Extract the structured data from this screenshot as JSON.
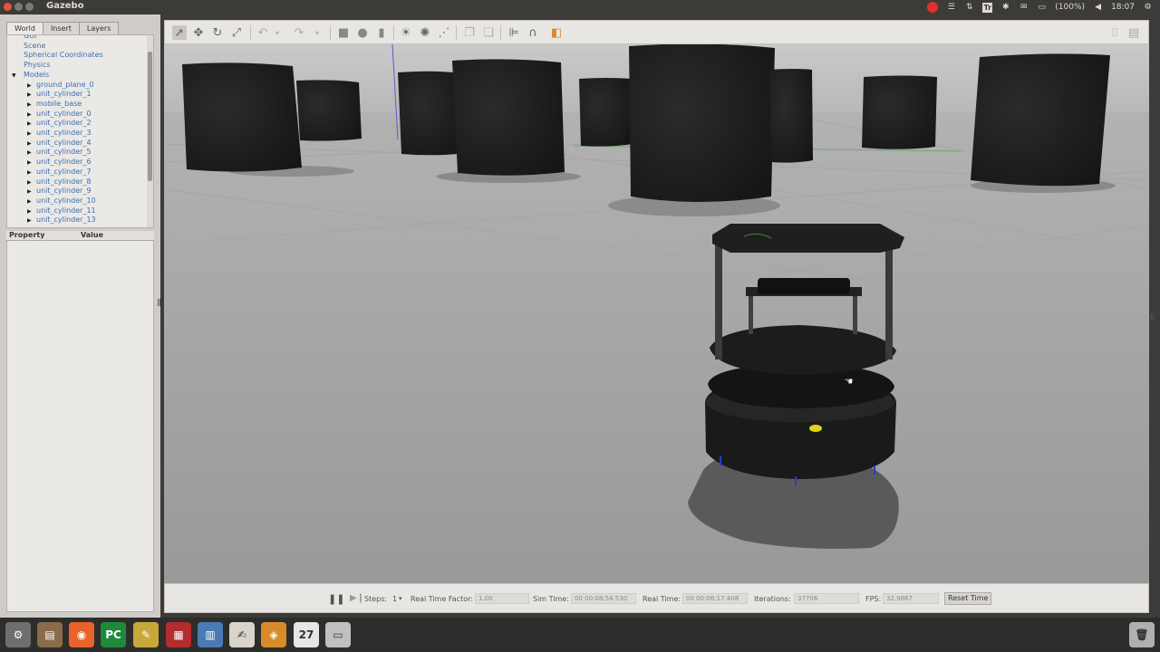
{
  "window": {
    "title": "Gazebo"
  },
  "tray": {
    "battery": "(100%)",
    "clock": "18:07",
    "keyboard": "Tr"
  },
  "left_panel": {
    "tabs": [
      "World",
      "Insert",
      "Layers"
    ],
    "tree_items": [
      {
        "label": "GUI",
        "indent": 0,
        "arrow": ""
      },
      {
        "label": "Scene",
        "indent": 0,
        "arrow": ""
      },
      {
        "label": "Spherical Coordinates",
        "indent": 0,
        "arrow": ""
      },
      {
        "label": "Physics",
        "indent": 0,
        "arrow": ""
      },
      {
        "label": "Models",
        "indent": 0,
        "arrow": "down"
      },
      {
        "label": "ground_plane_0",
        "indent": 1,
        "arrow": "right"
      },
      {
        "label": "unit_cylinder_1",
        "indent": 1,
        "arrow": "right"
      },
      {
        "label": "mobile_base",
        "indent": 1,
        "arrow": "right"
      },
      {
        "label": "unit_cylinder_0",
        "indent": 1,
        "arrow": "right"
      },
      {
        "label": "unit_cylinder_2",
        "indent": 1,
        "arrow": "right"
      },
      {
        "label": "unit_cylinder_3",
        "indent": 1,
        "arrow": "right"
      },
      {
        "label": "unit_cylinder_4",
        "indent": 1,
        "arrow": "right"
      },
      {
        "label": "unit_cylinder_5",
        "indent": 1,
        "arrow": "right"
      },
      {
        "label": "unit_cylinder_6",
        "indent": 1,
        "arrow": "right"
      },
      {
        "label": "unit_cylinder_7",
        "indent": 1,
        "arrow": "right"
      },
      {
        "label": "unit_cylinder_8",
        "indent": 1,
        "arrow": "right"
      },
      {
        "label": "unit_cylinder_9",
        "indent": 1,
        "arrow": "right"
      },
      {
        "label": "unit_cylinder_10",
        "indent": 1,
        "arrow": "right"
      },
      {
        "label": "unit_cylinder_11",
        "indent": 1,
        "arrow": "right"
      },
      {
        "label": "unit_cylinder_13",
        "indent": 1,
        "arrow": "right"
      }
    ],
    "property_header": {
      "property": "Property",
      "value": "Value"
    }
  },
  "toolbar": {
    "icons": [
      "select-arrow-icon",
      "translate-icon",
      "rotate-icon",
      "scale-icon",
      "undo-icon",
      "redo-icon",
      "box-icon",
      "sphere-icon",
      "cylinder-icon",
      "point-light-icon",
      "spot-light-icon",
      "directional-light-icon",
      "copy-icon",
      "paste-icon",
      "align-icon",
      "snap-icon",
      "view-angle-icon",
      "screenshot-icon"
    ]
  },
  "time_panel": {
    "steps_label": "Steps:",
    "steps_value": "1",
    "rtf_label": "Real Time Factor:",
    "rtf_value": "1.00",
    "sim_time_label": "Sim Time:",
    "sim_time_value": "00 00:08:54.530",
    "real_time_label": "Real Time:",
    "real_time_value": "00 00:06:17.408",
    "iterations_label": "Iterations:",
    "iterations_value": "37706",
    "fps_label": "FPS:",
    "fps_value": "32.9867",
    "reset_label": "Reset Time"
  },
  "launcher": {
    "apps": [
      {
        "name": "system-settings-icon",
        "color": "#6e6e6e",
        "glyph": "⚙"
      },
      {
        "name": "files-icon",
        "color": "#8a6b4a",
        "glyph": "▤"
      },
      {
        "name": "firefox-icon",
        "color": "#e8622a",
        "glyph": "◉"
      },
      {
        "name": "pycharm-icon",
        "color": "#1d8a3a",
        "glyph": "PC"
      },
      {
        "name": "diagram-tool-icon",
        "color": "#c9a83a",
        "glyph": "✎"
      },
      {
        "name": "code-editor-icon",
        "color": "#b32d2d",
        "glyph": "▦"
      },
      {
        "name": "network-monitor-icon",
        "color": "#4a7ab5",
        "glyph": "▥"
      },
      {
        "name": "text-editor-icon",
        "color": "#d8d4cc",
        "glyph": "✍"
      },
      {
        "name": "gazebo-icon",
        "color": "#d98b2a",
        "glyph": "◈"
      },
      {
        "name": "calendar-icon",
        "color": "#e6e6e6",
        "glyph": "27"
      },
      {
        "name": "terminal-icon",
        "color": "#c0c0c0",
        "glyph": "▭"
      },
      {
        "name": "trash-icon",
        "color": "#b0b0b0",
        "glyph": "🗑"
      }
    ]
  },
  "colors": {
    "accent_tab_text": "#3c6fb0",
    "record": "#e0312d"
  }
}
